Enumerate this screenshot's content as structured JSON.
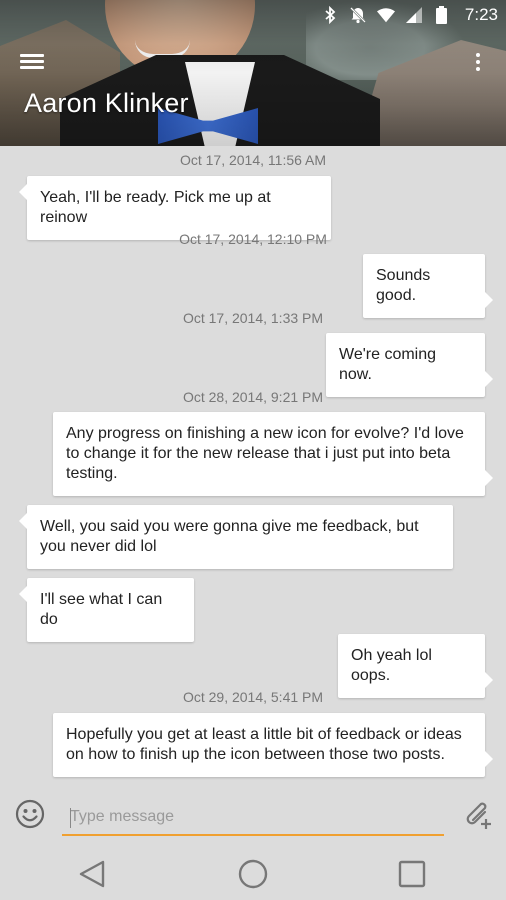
{
  "status_bar": {
    "time": "7:23",
    "icons": [
      "bluetooth-icon",
      "notifications-off-icon",
      "wifi-icon",
      "signal-icon",
      "battery-icon"
    ]
  },
  "toolbar": {
    "contact_name": "Aaron Klinker",
    "menu_icon": "hamburger-menu-icon",
    "overflow_icon": "more-vert-icon"
  },
  "messages": [
    {
      "type": "timestamp",
      "text": "Oct 17, 2014, 11:56 AM"
    },
    {
      "type": "incoming",
      "text": "Yeah, I'll be ready. Pick me up at reinow"
    },
    {
      "type": "timestamp",
      "text": "Oct 17, 2014, 12:10 PM"
    },
    {
      "type": "outgoing",
      "text": "Sounds good."
    },
    {
      "type": "timestamp",
      "text": "Oct 17, 2014, 1:33 PM"
    },
    {
      "type": "outgoing",
      "text": "We're coming now."
    },
    {
      "type": "timestamp",
      "text": "Oct 28, 2014, 9:21 PM"
    },
    {
      "type": "outgoing",
      "text": "Any progress on finishing a new icon for evolve? I'd love to change it for the new release that i just put into beta testing."
    },
    {
      "type": "incoming",
      "text": "Well, you said you were gonna give me feedback, but you never did lol"
    },
    {
      "type": "incoming",
      "text": "I'll see what I can do"
    },
    {
      "type": "outgoing",
      "text": "Oh yeah lol oops."
    },
    {
      "type": "timestamp",
      "text": "Oct 29, 2014, 5:41 PM"
    },
    {
      "type": "outgoing",
      "text": "Hopefully you get at least a little bit of feedback or ideas on how to finish up the icon between those two posts."
    }
  ],
  "composer": {
    "placeholder": "Type message",
    "value": "",
    "accent_color": "#f0a030"
  },
  "nav": {
    "icons": [
      "back-icon",
      "home-icon",
      "recents-icon"
    ]
  }
}
